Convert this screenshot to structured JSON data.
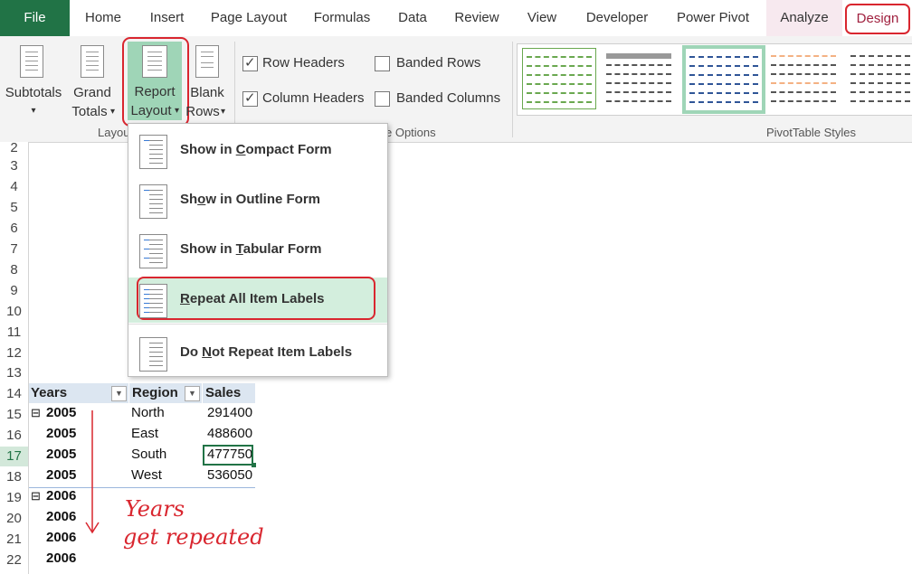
{
  "tabs": [
    "File",
    "Home",
    "Insert",
    "Page Layout",
    "Formulas",
    "Data",
    "Review",
    "View",
    "Developer",
    "Power Pivot",
    "Analyze",
    "Design"
  ],
  "ribbon": {
    "subtotals": "Subtotals",
    "grand_totals": [
      "Grand",
      "Totals"
    ],
    "report_layout": [
      "Report",
      "Layout"
    ],
    "blank_rows": [
      "Blank",
      "Rows"
    ],
    "layout_group": "Layou",
    "options": {
      "row_headers": "Row Headers",
      "column_headers": "Column Headers",
      "banded_rows": "Banded Rows",
      "banded_columns": "Banded Columns",
      "group_label": "e Options"
    },
    "styles_group": "PivotTable Styles",
    "colors": {
      "file_tab": "#217346",
      "design_tab": "#a0213f",
      "highlight": "#d9262f"
    }
  },
  "menu": {
    "items": [
      {
        "pre": "Show in ",
        "key": "C",
        "post": "ompact Form",
        "icon": "compact-form-icon"
      },
      {
        "pre": "Sh",
        "key": "o",
        "post": "w in Outline Form",
        "icon": "outline-form-icon"
      },
      {
        "pre": "Show in ",
        "key": "T",
        "post": "abular Form",
        "icon": "tabular-form-icon"
      },
      {
        "pre": "",
        "key": "R",
        "post": "epeat All Item Labels",
        "icon": "repeat-labels-icon"
      },
      {
        "pre": "Do ",
        "key": "N",
        "post": "ot Repeat Item Labels",
        "icon": "no-repeat-labels-icon"
      }
    ]
  },
  "rows": [
    "2",
    "3",
    "4",
    "5",
    "6",
    "7",
    "8",
    "9",
    "10",
    "11",
    "12",
    "13",
    "14",
    "15",
    "16",
    "17",
    "18",
    "19",
    "20",
    "21",
    "22"
  ],
  "pivot": {
    "headers": [
      "Years",
      "Region",
      "Sales"
    ],
    "data": [
      {
        "year": "2005",
        "region": "North",
        "sales": "291400",
        "expander": "⊟"
      },
      {
        "year": "2005",
        "region": "East",
        "sales": "488600"
      },
      {
        "year": "2005",
        "region": "South",
        "sales": "477750"
      },
      {
        "year": "2005",
        "region": "West",
        "sales": "536050"
      },
      {
        "year": "2006",
        "region": "",
        "sales": "",
        "expander": "⊟"
      },
      {
        "year": "2006",
        "region": "",
        "sales": ""
      },
      {
        "year": "2006",
        "region": "",
        "sales": ""
      },
      {
        "year": "2006",
        "region": "",
        "sales": ""
      }
    ]
  },
  "annotation": [
    "Years",
    "get repeated"
  ]
}
